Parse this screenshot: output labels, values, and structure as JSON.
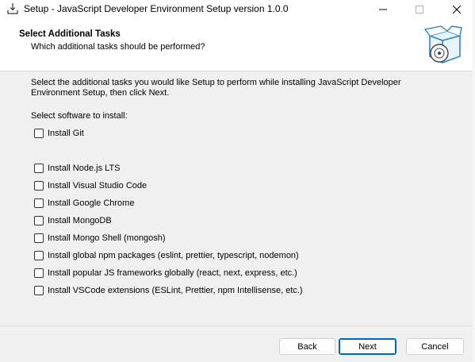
{
  "window": {
    "title": "Setup - JavaScript Developer Environment Setup version 1.0.0",
    "controls": {
      "minimize_icon": "minimize-icon",
      "maximize_icon": "maximize-icon",
      "close_icon": "close-icon"
    }
  },
  "header": {
    "title": "Select Additional Tasks",
    "subtitle": "Which additional tasks should be performed?",
    "image_icon": "setup-box-disc-icon"
  },
  "body": {
    "instructions": "Select the additional tasks you would like Setup to perform while installing JavaScript Developer Environment Setup, then click Next.",
    "select_label": "Select software to install:",
    "tasks": [
      {
        "label": "Install Git",
        "checked": false
      },
      {
        "label": "Install Node.js LTS",
        "checked": false
      },
      {
        "label": "Install Visual Studio Code",
        "checked": false
      },
      {
        "label": "Install Google Chrome",
        "checked": false
      },
      {
        "label": "Install MongoDB",
        "checked": false
      },
      {
        "label": "Install Mongo Shell (mongosh)",
        "checked": false
      },
      {
        "label": "Install global npm packages (eslint, prettier, typescript, nodemon)",
        "checked": false
      },
      {
        "label": "Install popular JS frameworks globally (react, next, express, etc.)",
        "checked": false
      },
      {
        "label": "Install VSCode extensions (ESLint, Prettier, npm Intellisense, etc.)",
        "checked": false
      }
    ]
  },
  "footer": {
    "back_label": "Back",
    "next_label": "Next",
    "cancel_label": "Cancel"
  },
  "colors": {
    "accent": "#0067c0",
    "header_bg": "#ffffff",
    "body_bg": "#f0f0f0"
  }
}
